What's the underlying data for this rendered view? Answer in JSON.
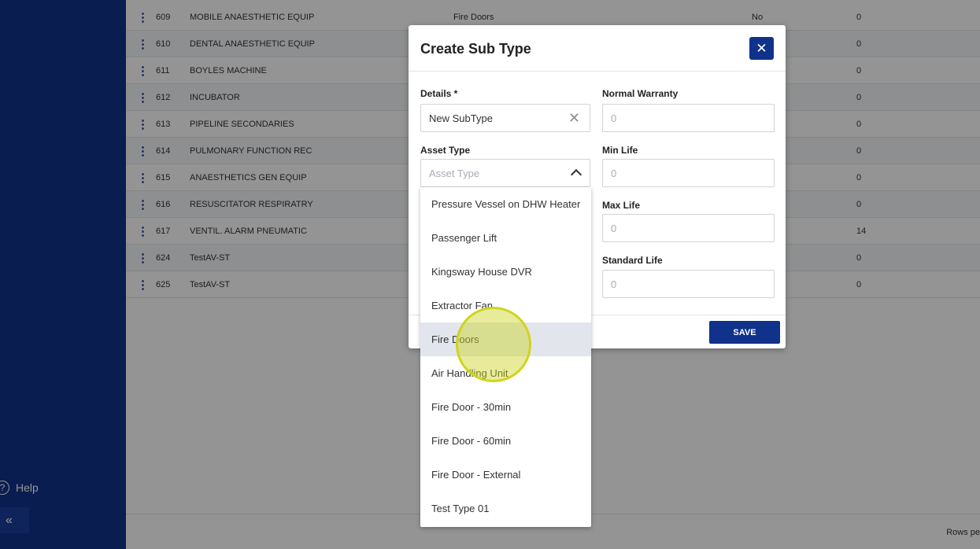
{
  "sidebar": {
    "help_label": "Help",
    "help_icon": "?",
    "collapse_icon": "«"
  },
  "table": {
    "rows": [
      {
        "code": "609",
        "name": "MOBILE ANAESTHETIC EQUIP",
        "type": "Fire Doors",
        "flag": "No",
        "num": "0"
      },
      {
        "code": "610",
        "name": "DENTAL ANAESTHETIC EQUIP",
        "type": "",
        "flag": "",
        "num": "0"
      },
      {
        "code": "611",
        "name": "BOYLES MACHINE",
        "type": "",
        "flag": "",
        "num": "0"
      },
      {
        "code": "612",
        "name": "INCUBATOR",
        "type": "",
        "flag": "",
        "num": "0"
      },
      {
        "code": "613",
        "name": "PIPELINE SECONDARIES",
        "type": "",
        "flag": "",
        "num": "0"
      },
      {
        "code": "614",
        "name": "PULMONARY FUNCTION REC",
        "type": "",
        "flag": "",
        "num": "0"
      },
      {
        "code": "615",
        "name": "ANAESTHETICS GEN EQUIP",
        "type": "",
        "flag": "",
        "num": "0"
      },
      {
        "code": "616",
        "name": "RESUSCITATOR RESPIRATRY",
        "type": "",
        "flag": "",
        "num": "0"
      },
      {
        "code": "617",
        "name": "VENTIL. ALARM PNEUMATIC",
        "type": "",
        "flag": "",
        "num": "14"
      },
      {
        "code": "624",
        "name": "TestAV-ST",
        "type": "",
        "flag": "",
        "num": "0"
      },
      {
        "code": "625",
        "name": "TestAV-ST",
        "type": "",
        "flag": "",
        "num": "0"
      }
    ],
    "row_menu_icon": "⋮",
    "rows_per_page_label": "Rows pe"
  },
  "modal": {
    "title": "Create Sub Type",
    "close_icon": "✕",
    "details_label": "Details *",
    "details_value": "New SubType",
    "clear_icon": "✕",
    "asset_type_label": "Asset Type",
    "asset_type_placeholder": "Asset Type",
    "normal_warranty_label": "Normal Warranty",
    "normal_warranty_value": "0",
    "min_life_label": "Min Life",
    "min_life_value": "0",
    "max_life_label": "Max Life",
    "max_life_value": "0",
    "standard_life_label": "Standard Life",
    "standard_life_value": "0",
    "save_label": "SAVE"
  },
  "dropdown": {
    "options": [
      "Pressure Vessel on DHW Heater",
      "Passenger Lift",
      "Kingsway House DVR",
      "Extractor Fan",
      "Fire Doors",
      "Air Handling Unit",
      "Fire Door - 30min",
      "Fire Door - 60min",
      "Fire Door - External",
      "Test Type 01"
    ],
    "highlighted_index": 4
  },
  "colors": {
    "brand": "#10328a",
    "highlight": "#e2e6ec",
    "click_indicator": "#cfd41e"
  }
}
